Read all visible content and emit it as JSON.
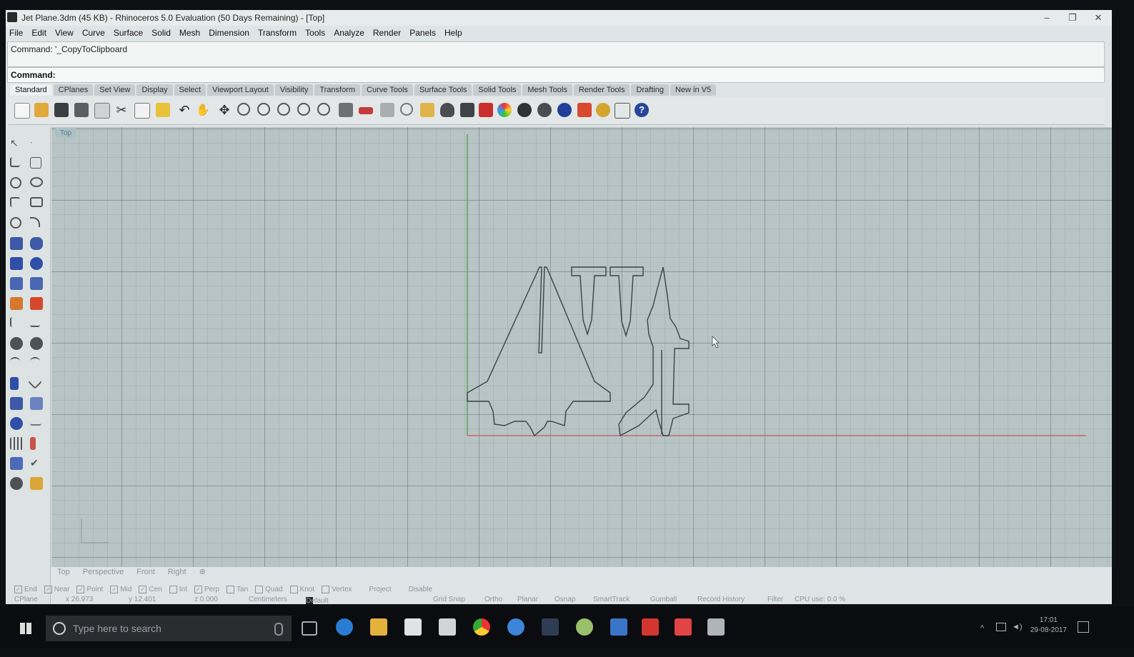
{
  "window": {
    "title": "Jet Plane.3dm (45 KB) - Rhinoceros 5.0 Evaluation (50 Days Remaining) - [Top]",
    "minimize": "–",
    "restore": "❐",
    "close": "✕"
  },
  "menu": [
    "File",
    "Edit",
    "View",
    "Curve",
    "Surface",
    "Solid",
    "Mesh",
    "Dimension",
    "Transform",
    "Tools",
    "Analyze",
    "Render",
    "Panels",
    "Help"
  ],
  "command": {
    "history": "Command: '_CopyToClipboard",
    "prompt": "Command:"
  },
  "toolbar_tabs": [
    "Standard",
    "CPlanes",
    "Set View",
    "Display",
    "Select",
    "Viewport Layout",
    "Visibility",
    "Transform",
    "Curve Tools",
    "Surface Tools",
    "Solid Tools",
    "Mesh Tools",
    "Render Tools",
    "Drafting",
    "New in V5"
  ],
  "active_tab": "Standard",
  "viewport": {
    "label": "Top"
  },
  "viewport_tabs": [
    "Top",
    "Perspective",
    "Front",
    "Right",
    "⊕"
  ],
  "osnaps": [
    {
      "label": "End",
      "checked": true
    },
    {
      "label": "Near",
      "checked": true
    },
    {
      "label": "Point",
      "checked": true
    },
    {
      "label": "Mid",
      "checked": true
    },
    {
      "label": "Cen",
      "checked": true
    },
    {
      "label": "Int",
      "checked": false
    },
    {
      "label": "Perp",
      "checked": true
    },
    {
      "label": "Tan",
      "checked": false
    },
    {
      "label": "Quad",
      "checked": false
    },
    {
      "label": "Knot",
      "checked": false
    },
    {
      "label": "Vertex",
      "checked": false
    }
  ],
  "osnap_extra": {
    "project": "Project",
    "disable": "Disable"
  },
  "status": {
    "cplane": "CPlane",
    "x": "x 26.973",
    "y": "y 12.401",
    "z": "z 0.000",
    "units": "Centimeters",
    "layer": "Default",
    "grid_snap": "Grid Snap",
    "ortho": "Ortho",
    "planar": "Planar",
    "osnap": "Osnap",
    "smarttrack": "SmartTrack",
    "gumball": "Gumball",
    "record_history": "Record History",
    "filter": "Filter",
    "cpu": "CPU use: 0.0 %"
  },
  "taskbar": {
    "search_placeholder": "Type here to search",
    "time": "17:01",
    "date": "29-08-2017"
  },
  "colors": {
    "viewport_bg": "#b8c4c5",
    "x_axis": "#c46a66",
    "y_axis": "#5fa35a",
    "curve": "#3b4347"
  }
}
